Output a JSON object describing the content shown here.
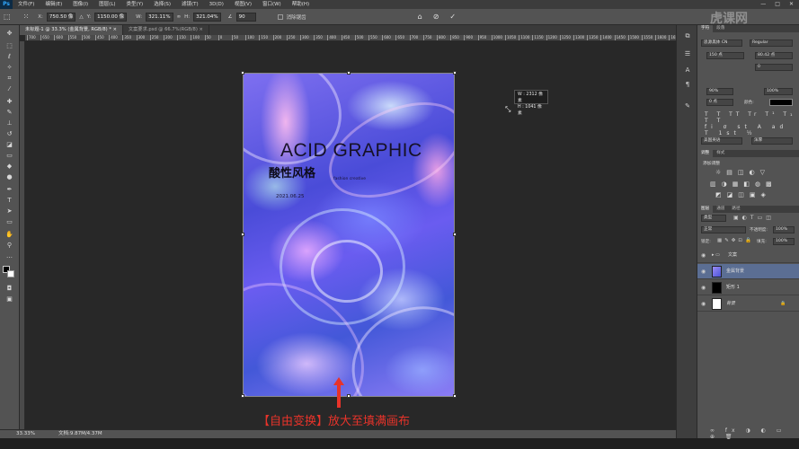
{
  "app": {
    "logo": "Ps"
  },
  "menu": [
    "文件(F)",
    "编辑(E)",
    "图像(I)",
    "图层(L)",
    "类型(Y)",
    "选择(S)",
    "滤镜(T)",
    "3D(D)",
    "视图(V)",
    "窗口(W)",
    "帮助(H)"
  ],
  "window_controls": [
    "—",
    "□",
    "✕"
  ],
  "options_bar": {
    "x_label": "X:",
    "x_value": "750.50 像",
    "y_label": "Y:",
    "y_value": "1150.00 像",
    "w_label": "W:",
    "w_value": "321.11%",
    "h_label": "H:",
    "h_value": "321.04%",
    "angle_value": "90",
    "interp_label": "插值: ",
    "warp_label": "消除锯齿",
    "cancel_icon": "cancel-icon",
    "commit_icon": "commit-icon"
  },
  "tabs": [
    {
      "label": "未标题-1 @ 33.3% (金属背景, RGB/8) * ×",
      "active": true
    },
    {
      "label": "文案要求.psd @ 66.7%(RGB/8) ×",
      "active": false
    }
  ],
  "ruler_ticks": [
    "700",
    "650",
    "600",
    "550",
    "500",
    "450",
    "400",
    "350",
    "300",
    "250",
    "200",
    "150",
    "100",
    "50",
    "0",
    "50",
    "100",
    "150",
    "200",
    "250",
    "300",
    "350",
    "400",
    "450",
    "500",
    "550",
    "600",
    "650",
    "700",
    "750",
    "800",
    "850",
    "900",
    "950",
    "1000",
    "1050",
    "1100",
    "1150",
    "1200",
    "1250",
    "1300",
    "1350",
    "1400",
    "1450",
    "1500",
    "1550",
    "1600",
    "1650"
  ],
  "canvas": {
    "title_en": "ACID GRAPHIC",
    "title_zh": "酸性风格",
    "subtitle": "fashion creative",
    "date": "2021.06.25"
  },
  "transform_tooltip": {
    "w": "W : 2312 像素",
    "h": "H : 1041 像素"
  },
  "caption": "【自由变换】放大至填满画布",
  "status": {
    "zoom": "33.33%",
    "doc": "文档:9.87M/4.37M"
  },
  "panels": {
    "char_tabs": [
      "字符",
      "段落"
    ],
    "font_family": "思源黑体 CN",
    "font_style": "Regular",
    "font_size": "150 点",
    "leading": "80.42 点",
    "tracking": "0",
    "vscale": "90%",
    "hscale": "100%",
    "baseline": "0 点",
    "color_label": "颜色:",
    "lang": "美国英语",
    "aa": "浑厚",
    "adjust_tabs": [
      "调整",
      "样式"
    ],
    "adjust_title": "添加调整",
    "layers_tabs": [
      "图层",
      "通道",
      "路径"
    ],
    "kind": "类型",
    "blend": "正常",
    "opacity_label": "不透明度:",
    "opacity": "100%",
    "lock_label": "锁定:",
    "fill_label": "填充:",
    "fill": "100%",
    "layers": [
      {
        "name": "文案",
        "type": "group",
        "selected": false
      },
      {
        "name": "金属背景",
        "type": "smart",
        "selected": true
      },
      {
        "name": "矩形 1",
        "type": "shape",
        "selected": false
      },
      {
        "name": "背景",
        "type": "background",
        "selected": false
      }
    ]
  },
  "watermark": "虎课网"
}
